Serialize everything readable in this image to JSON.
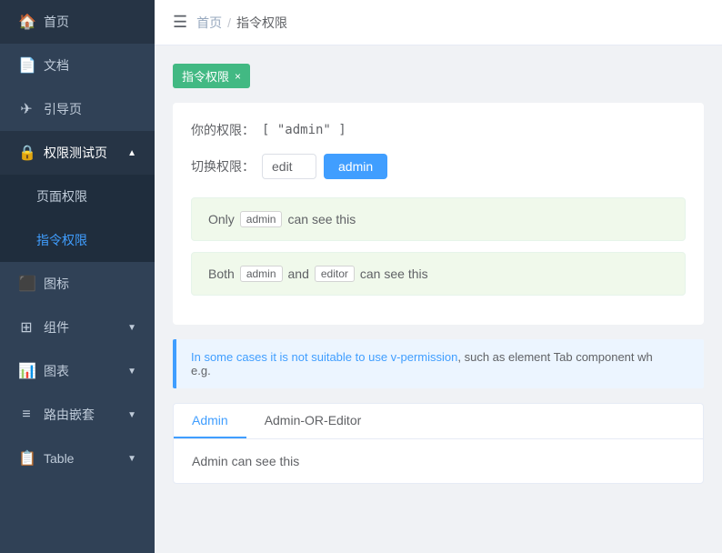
{
  "sidebar": {
    "items": [
      {
        "id": "home",
        "label": "首页",
        "icon": "🏠",
        "active": false
      },
      {
        "id": "docs",
        "label": "文档",
        "icon": "📄",
        "active": false
      },
      {
        "id": "guide",
        "label": "引导页",
        "icon": "✈",
        "active": false
      },
      {
        "id": "permission",
        "label": "权限测试页",
        "icon": "🔒",
        "active": true,
        "arrow": "▲",
        "children": [
          {
            "id": "page-perm",
            "label": "页面权限",
            "active": false
          },
          {
            "id": "cmd-perm",
            "label": "指令权限",
            "active": true
          }
        ]
      },
      {
        "id": "icons",
        "label": "图标",
        "icon": "⬛",
        "active": false
      },
      {
        "id": "components",
        "label": "组件",
        "icon": "⊞",
        "active": false,
        "arrow": "▼"
      },
      {
        "id": "charts",
        "label": "图表",
        "icon": "📊",
        "active": false,
        "arrow": "▼"
      },
      {
        "id": "routes",
        "label": "路由嵌套",
        "icon": "≡",
        "active": false,
        "arrow": "▼"
      },
      {
        "id": "table",
        "label": "Table",
        "icon": "📋",
        "active": false,
        "arrow": "▼"
      }
    ]
  },
  "header": {
    "breadcrumb": {
      "home": "首页",
      "sep": "/",
      "current": "指令权限"
    }
  },
  "tag": {
    "label": "指令权限",
    "close": "×"
  },
  "permission": {
    "label": "你的权限：",
    "value": "[ \"admin\" ]"
  },
  "switch": {
    "label": "切换权限：",
    "input_value": "edit",
    "button_label": "admin"
  },
  "perm_boxes": [
    {
      "prefix": "Only",
      "badge1": "admin",
      "middle": "",
      "badge2": "",
      "suffix": "can see this"
    },
    {
      "prefix": "Both",
      "badge1": "admin",
      "middle": "and",
      "badge2": "editor",
      "suffix": "can see this"
    }
  ],
  "info": {
    "text_before": "In some cases it is not suitable to use v-permission, such as element Tab component wh",
    "text_after": "e.g."
  },
  "tabs": {
    "tab1": "Admin",
    "tab2": "Admin-OR-Editor",
    "content": "Admin can see this"
  }
}
